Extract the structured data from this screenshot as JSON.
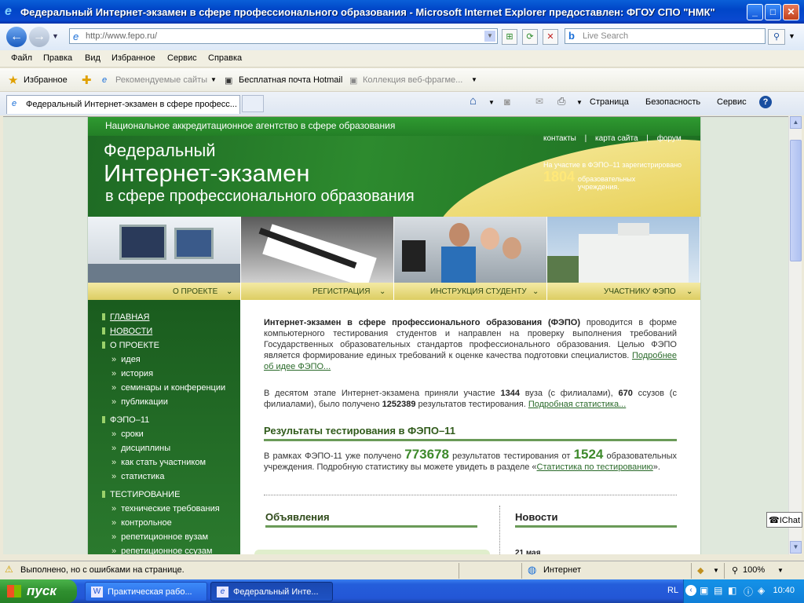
{
  "window": {
    "title": "Федеральный Интернет-экзамен в сфере профессионального образования - Microsoft Internet Explorer предоставлен: ФГОУ СПО \"НМК\""
  },
  "address": {
    "url": "http://www.fepo.ru/"
  },
  "search": {
    "placeholder": "Live Search"
  },
  "menu": [
    "Файл",
    "Правка",
    "Вид",
    "Избранное",
    "Сервис",
    "Справка"
  ],
  "favorites": {
    "label": "Избранное",
    "items": [
      "Рекомендуемые сайты",
      "Бесплатная почта Hotmail",
      "Коллекция веб-фрагме..."
    ]
  },
  "tab": {
    "title": "Федеральный Интернет-экзамен в сфере професс..."
  },
  "commands": [
    "Страница",
    "Безопасность",
    "Сервис"
  ],
  "site": {
    "agency": "Национальное аккредитационное агентство в сфере образования",
    "title1": "Федеральный",
    "title2": "Интернет-экзамен",
    "title3": "в сфере профессионального образования",
    "links": [
      "контакты",
      "карта сайта",
      "форум"
    ],
    "reg_text": "На участие в ФЭПО–11 зарегистрировано",
    "reg_count": "1804",
    "reg_text2": "образовательных учреждения.",
    "nav": [
      "О ПРОЕКТЕ",
      "РЕГИСТРАЦИЯ",
      "ИНСТРУКЦИЯ СТУДЕНТУ",
      "УЧАСТНИКУ ФЭПО"
    ],
    "left_menu": {
      "main": "ГЛАВНАЯ",
      "news": "НОВОСТИ",
      "about": "О ПРОЕКТЕ",
      "about_items": [
        "идея",
        "история",
        "семинары и конференции",
        "публикации"
      ],
      "fepo": "ФЭПО–11",
      "fepo_items": [
        "сроки",
        "дисциплины",
        "как стать участником",
        "статистика"
      ],
      "testing": "ТЕСТИРОВАНИЕ",
      "testing_items": [
        "технические требования",
        "контрольное",
        "репетиционное вузам",
        "репетиционное ссузам"
      ]
    },
    "intro_bold": "Интернет-экзамен в сфере профессионального образования (ФЭПО)",
    "intro_text": " проводится в форме компьютерного тестирования студентов и направлен на проверку выполнения требований Государственных образовательных стандартов профессионального образования. Целью ФЭПО является формирование единых требований к оценке качества подготовки специалистов. ",
    "intro_link": "Подробнее об идее ФЭПО...",
    "stage_a": "В десятом этапе Интернет-экзамена приняли участие ",
    "stage_vuz": "1344",
    "stage_b": " вуза (с филиалами), ",
    "stage_ssuz": "670",
    "stage_c": " ссузов (с филиалами), было получено ",
    "stage_results": "1252389",
    "stage_d": " результатов тестирования. ",
    "stage_link": "Подробная статистика...",
    "results_title": "Результаты тестирования в ФЭПО–11",
    "res_a": "В рамках ФЭПО-11 уже получено ",
    "res_count": "773678",
    "res_b": " результатов тестирования от ",
    "res_orgs": "1524",
    "res_c": " образовательных учреждения. Подробную статистику вы можете увидеть в разделе «",
    "res_link": "Статистика по тестированию",
    "res_d": "».",
    "announcements": "Объявления",
    "news_title": "Новости",
    "news_date": "21 мая"
  },
  "ichat": "IChat",
  "status": {
    "text": "Выполнено, но с ошибками на странице.",
    "zone": "Интернет",
    "zoom": "100%"
  },
  "taskbar": {
    "start": "пуск",
    "tasks": [
      "Практическая рабо...",
      "Федеральный Инте..."
    ],
    "lang": "RL",
    "time": "10:40"
  }
}
